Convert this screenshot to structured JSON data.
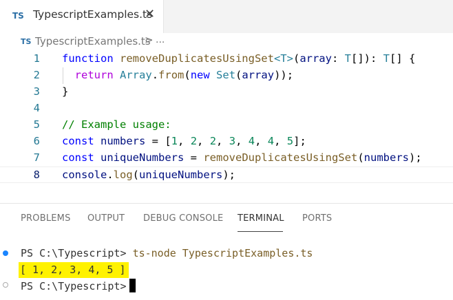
{
  "tab": {
    "icon": "TS",
    "filename": "TypescriptExamples.ts",
    "close": "✕"
  },
  "breadcrumb": {
    "icon": "TS",
    "filename": "TypescriptExamples.ts",
    "separator": ">",
    "more": "..."
  },
  "editor": {
    "line_numbers": [
      "1",
      "2",
      "3",
      "4",
      "5",
      "6",
      "7",
      "8"
    ],
    "lines": [
      "function removeDuplicatesUsingSet<T>(array: T[]): T[] {",
      "  return Array.from(new Set(array));",
      "}",
      "",
      "// Example usage:",
      "const numbers = [1, 2, 2, 3, 4, 4, 5];",
      "const uniqueNumbers = removeDuplicatesUsingSet(numbers);",
      "console.log(uniqueNumbers);"
    ],
    "current_line": 8
  },
  "panel": {
    "tabs": [
      "PROBLEMS",
      "OUTPUT",
      "DEBUG CONSOLE",
      "TERMINAL",
      "PORTS"
    ],
    "active_tab": "TERMINAL"
  },
  "terminal": {
    "prompt": "PS C:\\Typescript>",
    "command": "ts-node TypescriptExamples.ts",
    "output": "[ 1, 2, 3, 4, 5 ]",
    "prompt2": "PS C:\\Typescript>"
  },
  "colors": {
    "accent": "#1a85ff",
    "highlight": "#fff200",
    "ts_icon": "#2a6ea5"
  }
}
